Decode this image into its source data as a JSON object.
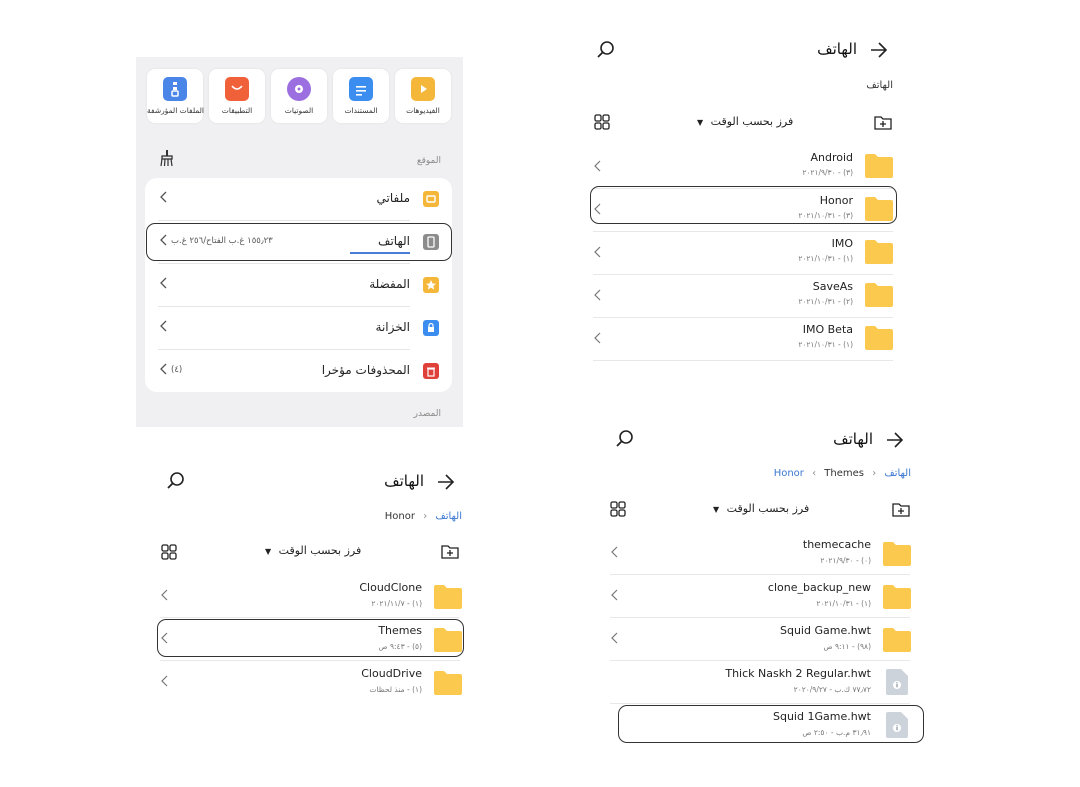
{
  "panel1": {
    "categories": [
      {
        "label": "الملفات المؤرشفة"
      },
      {
        "label": "التطبيقات"
      },
      {
        "label": "الصوتيات"
      },
      {
        "label": "المستندات"
      },
      {
        "label": "الفيديوهات"
      }
    ],
    "section_location": "الموقع",
    "section_source": "المصدر",
    "locations": [
      {
        "label": "ملفاتي",
        "sub": ""
      },
      {
        "label": "الهاتف",
        "sub": "١٥٥٫٢٣ غ.ب الفتاح/٢٥٦ غ.ب"
      },
      {
        "label": "المفضلة",
        "sub": ""
      },
      {
        "label": "الخزانة",
        "sub": ""
      },
      {
        "label": "المحذوفات مؤخرا",
        "sub": "(٤)"
      }
    ]
  },
  "panel2": {
    "title": "الهاتف",
    "breadcrumb": "الهاتف",
    "sort_label": "فرز بحسب الوقت",
    "items": [
      {
        "name": "Android",
        "meta": "(٣) - ٢٠٢١/٩/٣٠"
      },
      {
        "name": "Honor",
        "meta": "(٣) - ٢٠٢١/١٠/٣١"
      },
      {
        "name": "IMO",
        "meta": "(١) - ٢٠٢١/١٠/٣١"
      },
      {
        "name": "SaveAs",
        "meta": "(٢) - ٢٠٢١/١٠/٣١"
      },
      {
        "name": "IMO Beta",
        "meta": "(١) - ٢٠٢١/١٠/٣١"
      }
    ]
  },
  "panel3": {
    "title": "الهاتف",
    "breadcrumb_root": "الهاتف",
    "breadcrumb_current": "Honor",
    "sort_label": "فرز بحسب الوقت",
    "items": [
      {
        "name": "CloudClone",
        "meta": "(١) - ٢٠٢١/١١/٧"
      },
      {
        "name": "Themes",
        "meta": "(٥) - ٩:٤٣ ص"
      },
      {
        "name": "CloudDrive",
        "meta": "(١) - منذ لحظات"
      }
    ]
  },
  "panel4": {
    "title": "الهاتف",
    "breadcrumb_root": "الهاتف",
    "breadcrumb_mid": "Honor",
    "breadcrumb_current": "Themes",
    "sort_label": "فرز بحسب الوقت",
    "items": [
      {
        "name": "themecache",
        "meta": "(٠) - ٢٠٢١/٩/٣٠",
        "kind": "folder"
      },
      {
        "name": "clone_backup_new",
        "meta": "(١) - ٢٠٢١/١٠/٣١",
        "kind": "folder"
      },
      {
        "name": "Squid Game.hwt",
        "meta": "(٩٨) - ٩:١١ ص",
        "kind": "folder"
      },
      {
        "name": "Thick Naskh 2 Regular.hwt",
        "meta": "٧٧٫٧٢ ك.ب - ٢٠٢٠/٩/٢٧",
        "kind": "file"
      },
      {
        "name": "Squid 1Game.hwt",
        "meta": "٣١٫٩١ م.ب - ٢:٥٠ ص",
        "kind": "file"
      }
    ]
  },
  "colors": {
    "folder": "#fcc94f",
    "accent": "#3a78d1",
    "archive": "#4a86e8",
    "apps": "#f0613a",
    "audio": "#9b6fe0",
    "docs": "#3b8ef0",
    "video": "#f4b73a",
    "favorites": "#f4b73a",
    "vault": "#3b8ef0",
    "trash": "#e0403a"
  }
}
